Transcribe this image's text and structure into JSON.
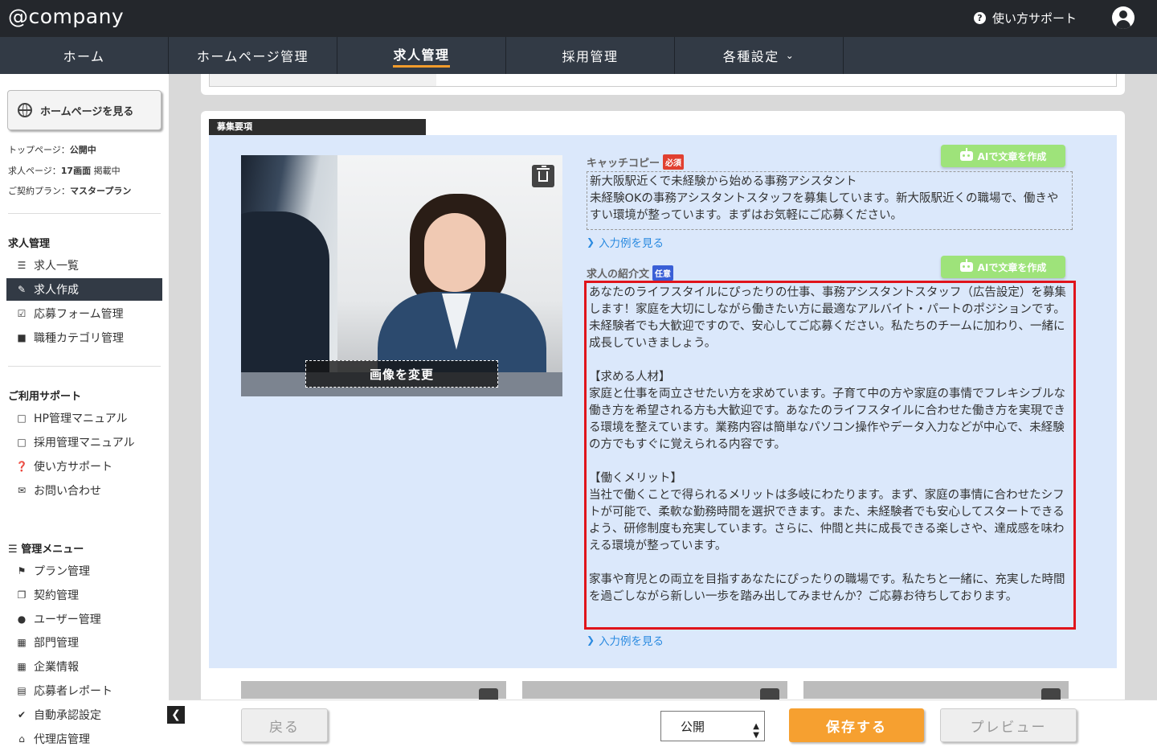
{
  "header": {
    "logo_text": "@company",
    "help_label": "使い方サポート"
  },
  "nav": {
    "items": [
      {
        "label": "ホーム"
      },
      {
        "label": "ホームページ管理"
      },
      {
        "label": "求人管理",
        "active": true
      },
      {
        "label": "採用管理"
      },
      {
        "label": "各種設定"
      }
    ]
  },
  "sidebar": {
    "view_hp_label": "ホームページを見る",
    "status": {
      "top_page_label": "トップページ：",
      "top_page_value": "公開中",
      "job_page_label": "求人ページ：",
      "job_page_value": "17画面",
      "job_page_suffix": " 掲載中",
      "plan_label": "ご契約プラン：",
      "plan_value": "マスタープラン"
    },
    "sections": [
      {
        "title": "求人管理",
        "items": [
          {
            "label": "求人一覧",
            "icon": "list-icon"
          },
          {
            "label": "求人作成",
            "icon": "edit-icon",
            "active": true
          },
          {
            "label": "応募フォーム管理",
            "icon": "checkbox-icon"
          },
          {
            "label": "職種カテゴリ管理",
            "icon": "briefcase-icon"
          }
        ]
      },
      {
        "title": "ご利用サポート",
        "items": [
          {
            "label": "HP管理マニュアル",
            "icon": "pdf-icon"
          },
          {
            "label": "採用管理マニュアル",
            "icon": "pdf-icon"
          },
          {
            "label": "使い方サポート",
            "icon": "question-icon"
          },
          {
            "label": "お問い合わせ",
            "icon": "envelope-icon"
          }
        ]
      },
      {
        "title": "管理メニュー",
        "items": [
          {
            "label": "プラン管理",
            "icon": "flag-icon"
          },
          {
            "label": "契約管理",
            "icon": "copy-icon"
          },
          {
            "label": "ユーザー管理",
            "icon": "user-icon"
          },
          {
            "label": "部門管理",
            "icon": "building-icon"
          },
          {
            "label": "企業情報",
            "icon": "building-icon"
          },
          {
            "label": "応募者レポート",
            "icon": "id-card-icon"
          },
          {
            "label": "自動承認設定",
            "icon": "check-circle-icon"
          },
          {
            "label": "代理店管理",
            "icon": "bank-icon"
          }
        ]
      }
    ]
  },
  "main": {
    "section_tab": "募集要項",
    "change_image_label": "画像を変更",
    "catch_copy": {
      "label": "キャッチコピー",
      "badge": "必須",
      "ai_button": "AIで文章を作成",
      "text": "新大阪駅近くで未経験から始める事務アシスタント\n未経験OKの事務アシスタントスタッフを募集しています。新大阪駅近くの職場で、働きやすい環境が整っています。まずはお気軽にご応募ください。",
      "example_link": "入力例を見る"
    },
    "intro": {
      "label": "求人の紹介文",
      "badge": "任意",
      "ai_button": "AIで文章を作成",
      "text": "あなたのライフスタイルにぴったりの仕事、事務アシスタントスタッフ（広告設定）を募集します！家庭を大切にしながら働きたい方に最適なアルバイト・パートのポジションです。未経験者でも大歓迎ですので、安心してご応募ください。私たちのチームに加わり、一緒に成長していきましょう。\n\n【求める人材】\n家庭と仕事を両立させたい方を求めています。子育て中の方や家庭の事情でフレキシブルな働き方を希望される方も大歓迎です。あなたのライフスタイルに合わせた働き方を実現できる環境を整えています。業務内容は簡単なパソコン操作やデータ入力などが中心で、未経験の方でもすぐに覚えられる内容です。\n\n【働くメリット】\n当社で働くことで得られるメリットは多岐にわたります。まず、家庭の事情に合わせたシフトが可能で、柔軟な勤務時間を選択できます。また、未経験者でも安心してスタートできるよう、研修制度も充実しています。さらに、仲間と共に成長できる楽しさや、達成感を味わえる環境が整っています。\n\n家事や育児との両立を目指すあなたにぴったりの職場です。私たちと一緒に、充実した時間を過ごしながら新しい一歩を踏み出してみませんか？ご応募お待ちしております。",
      "example_link": "入力例を見る"
    }
  },
  "bottombar": {
    "back_label": "戻る",
    "status_select": "公開",
    "save_label": "保存する",
    "preview_label": "プレビュー"
  },
  "colors": {
    "header_bg": "#24272c",
    "nav_bg": "#323a45",
    "accent": "#f39c2c",
    "ai_button": "#9ee37a",
    "highlight_border": "#e0141b",
    "form_bg": "#dbe8fb"
  }
}
